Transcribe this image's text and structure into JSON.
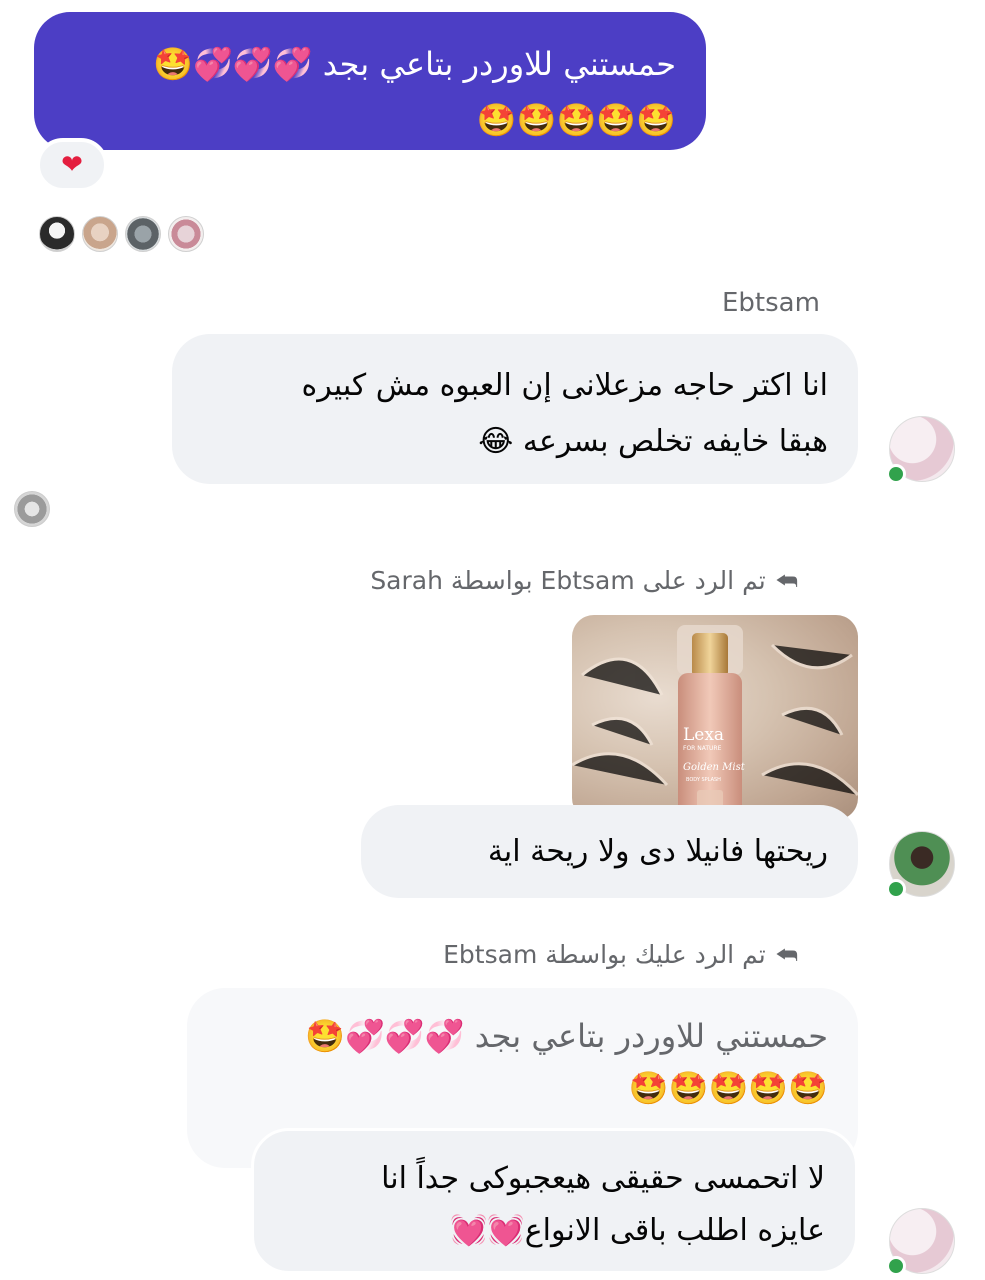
{
  "own_message": {
    "line1": "حمستني للاوردر بتاعي بجد 💞💞💞🤩",
    "line2": "🤩🤩🤩🤩🤩",
    "reaction": "❤"
  },
  "messages": [
    {
      "sender": "Ebtsam",
      "line1": "انا اكتر حاجه مزعلانى إن العبوه مش كبيره",
      "line2": "هبقا خايفه تخلص بسرعه 😂"
    },
    {
      "reply_meta": "تم الرد على Ebtsam بواسطة Sarah",
      "photo": {
        "brand": "Lexa",
        "brand_sub": "FOR NATURE",
        "product": "Golden Mist",
        "product_sub": "BODY SPLASH"
      },
      "text": "ريحتها فانيلا دى ولا ريحة اية"
    },
    {
      "reply_meta": "تم الرد عليك بواسطة Ebtsam",
      "quoted_line1": "حمستني للاوردر بتاعي بجد 💞💞💞🤩",
      "quoted_line2": "🤩🤩🤩🤩🤩",
      "line1": "لا اتحمسى حقيقى هيعجبوكى جداً انا",
      "line2": "عايزه اطلب باقى الانواع💓💓"
    }
  ],
  "colors": {
    "own_bubble": "#4c3ec5",
    "other_bubble": "#f0f2f5",
    "online": "#31a24c",
    "meta_text": "#65676b"
  },
  "icons": {
    "reaction": "red-heart",
    "reply": "reply-arrow"
  }
}
